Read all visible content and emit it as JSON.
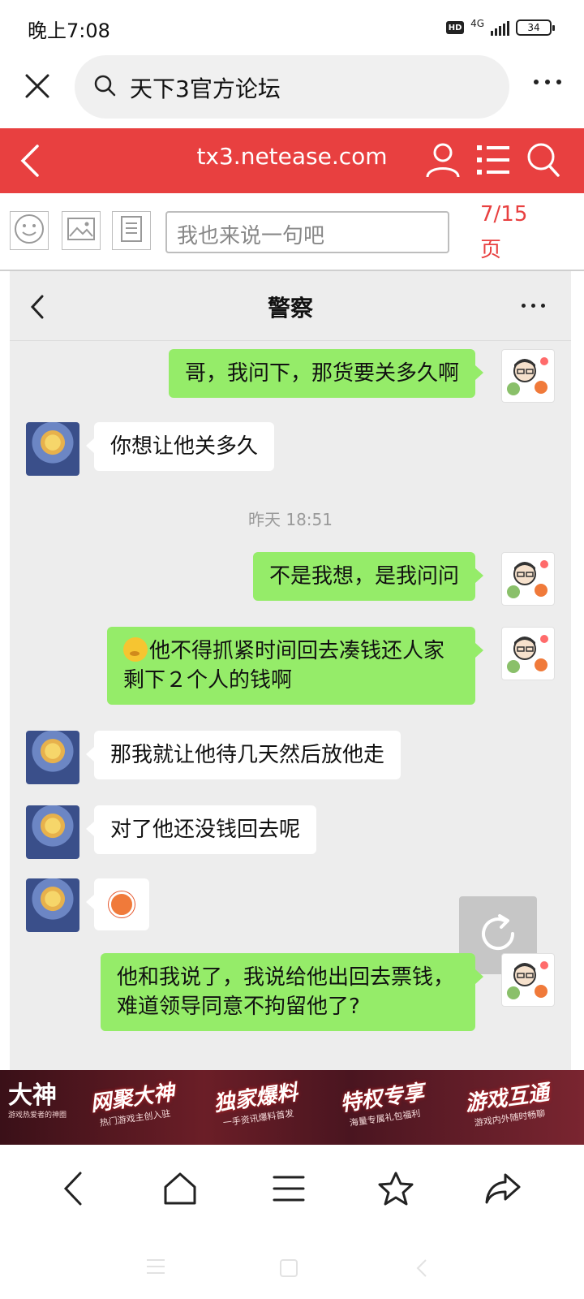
{
  "status_bar": {
    "time": "晚上7:08",
    "hd_badge": "HD",
    "network": "4G",
    "battery": "34"
  },
  "browser": {
    "address_text": "天下3官方论坛",
    "close_icon": "close-icon",
    "more_icon": "more-dots-icon"
  },
  "site_header": {
    "domain": "tx3.netease.com",
    "background": "#e84040"
  },
  "comment_bar": {
    "placeholder": "我也来说一句吧",
    "page_indicator": "7/15页"
  },
  "chat": {
    "title": "警察",
    "timestamp": "昨天 18:51",
    "messages": [
      {
        "side": "me",
        "text": "哥，我问下，那货要关多久啊"
      },
      {
        "side": "them",
        "text": "你想让他关多久"
      },
      {
        "side": "me",
        "text": "不是我想，是我问问"
      },
      {
        "side": "me",
        "text": "他不得抓紧时间回去凑钱还人家剩下２个人的钱啊"
      },
      {
        "side": "them",
        "text": "那我就让他待几天然后放他走"
      },
      {
        "side": "them",
        "text": "对了他还没钱回去呢"
      },
      {
        "side": "them",
        "text": ""
      },
      {
        "side": "me",
        "text": "他和我说了，我说给他出回去票钱，难道领导同意不拘留他了?"
      }
    ],
    "bubble_me_color": "#95ec69",
    "bubble_them_color": "#ffffff"
  },
  "banner": {
    "logo": "大神",
    "logo_sub": "游戏热爱者的神圈",
    "items": [
      {
        "title": "网聚大神",
        "sub": "热门游戏主创入驻"
      },
      {
        "title": "独家爆料",
        "sub": "一手资讯爆料首发"
      },
      {
        "title": "特权专享",
        "sub": "海量专属礼包福利"
      },
      {
        "title": "游戏互通",
        "sub": "游戏内外随时畅聊"
      }
    ]
  }
}
